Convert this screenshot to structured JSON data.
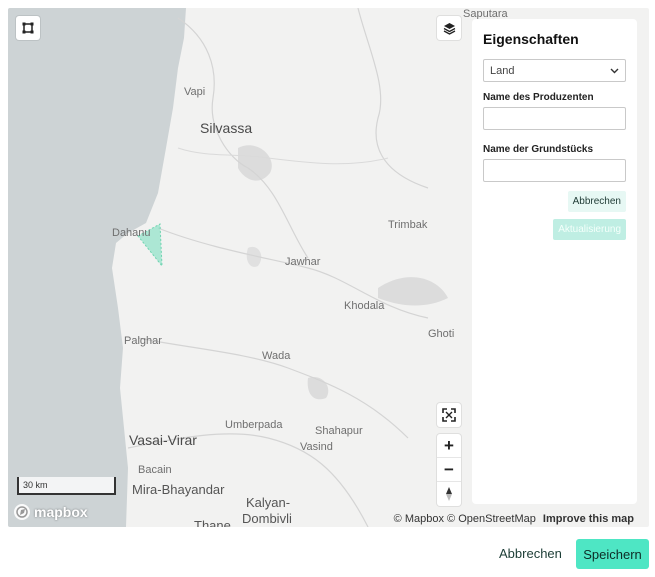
{
  "map": {
    "places": [
      {
        "name": "Saputara",
        "cls": "place"
      },
      {
        "name": "Vapi",
        "cls": "place"
      },
      {
        "name": "Silvassa",
        "cls": "place city"
      },
      {
        "name": "Dahanu",
        "cls": "place"
      },
      {
        "name": "Trimbak",
        "cls": "place"
      },
      {
        "name": "Jawhar",
        "cls": "place"
      },
      {
        "name": "Khodala",
        "cls": "place"
      },
      {
        "name": "Ghoti",
        "cls": "place"
      },
      {
        "name": "Palghar",
        "cls": "place"
      },
      {
        "name": "Wada",
        "cls": "place"
      },
      {
        "name": "Umberpada",
        "cls": "place"
      },
      {
        "name": "Shahapur",
        "cls": "place"
      },
      {
        "name": "Vasind",
        "cls": "place"
      },
      {
        "name": "Vasai-Virar",
        "cls": "place city"
      },
      {
        "name": "Bacain",
        "cls": "place"
      },
      {
        "name": "Mira-Bhayandar",
        "cls": "place big"
      },
      {
        "name": "Kalyan-",
        "cls": "place big"
      },
      {
        "name": "Dombivli",
        "cls": "place big"
      },
      {
        "name": "Thane",
        "cls": "place big"
      }
    ],
    "scale_label": "30 km",
    "logo_text": "mapbox",
    "attribution": {
      "mapbox": "© Mapbox",
      "osm": "© OpenStreetMap",
      "improve": "Improve this map"
    },
    "colors": {
      "water": "#cdd3d5",
      "land": "#f2f2f1",
      "polygon": "#8fe3c7",
      "roads": "#d6d6d6"
    }
  },
  "controls": {
    "draw_icon": "square-draw-icon",
    "layers_icon": "layers-icon",
    "fullscreen_icon": "fullscreen-icon",
    "zoom_in": "+",
    "zoom_out": "−",
    "compass_icon": "compass-icon"
  },
  "panel": {
    "title": "Eigenschaften",
    "select_value": "Land",
    "producer_label": "Name des Produzenten",
    "producer_value": "",
    "plot_label": "Name der Grundstücks",
    "plot_value": "",
    "cancel_label": "Abbrechen",
    "update_label": "Aktualisierung"
  },
  "footer": {
    "cancel_label": "Abbrechen",
    "save_label": "Speichern",
    "accent": "#4ee6c4"
  }
}
